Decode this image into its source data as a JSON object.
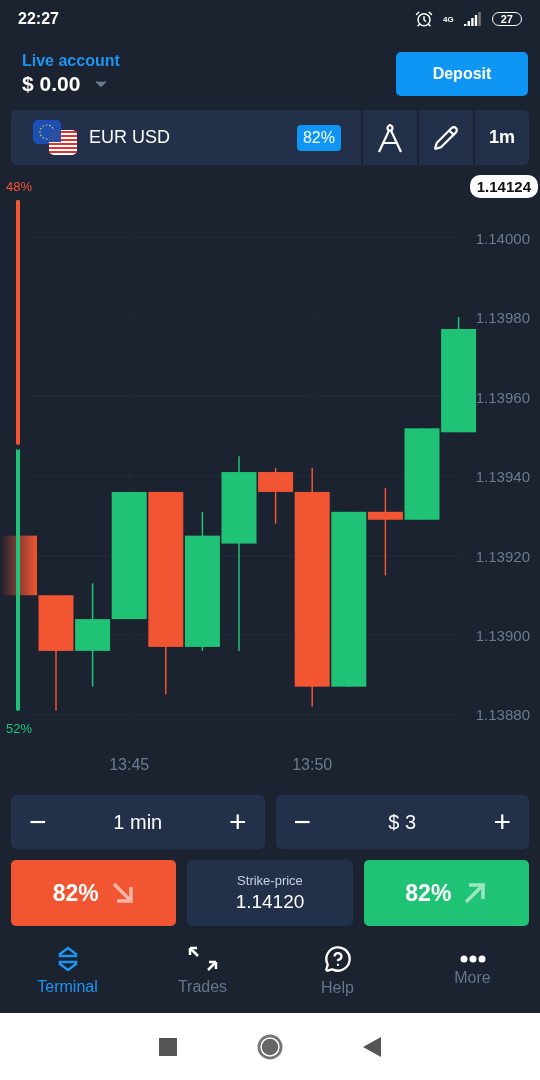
{
  "status_bar": {
    "time": "22:27",
    "network": "4G",
    "battery": "27"
  },
  "account": {
    "label": "Live account",
    "balance": "$ 0.00"
  },
  "deposit_button": "Deposit",
  "asset_bar": {
    "pair": "EUR USD",
    "payout": "82%",
    "timeframe": "1m"
  },
  "chart": {
    "current_price": "1.14124",
    "sentiment": {
      "down_label": "48%",
      "up_label": "52%",
      "level": 0.48
    },
    "price_labels": [
      "1.14000",
      "1.13980",
      "1.13960",
      "1.13940",
      "1.13920",
      "1.13900",
      "1.13880"
    ],
    "time_labels": [
      "13:45",
      "13:50"
    ]
  },
  "controls": [
    {
      "value": "1 min",
      "minus": "−",
      "plus": "+"
    },
    {
      "value": "$ 3",
      "minus": "−",
      "plus": "+"
    }
  ],
  "trade": {
    "down": "82%",
    "strike_label": "Strike-price",
    "strike_value": "1.14120",
    "up": "82%"
  },
  "nav": [
    {
      "label": "Terminal",
      "kind": "terminal",
      "selected": true
    },
    {
      "label": "Trades",
      "kind": "trades",
      "selected": false
    },
    {
      "label": "Help",
      "kind": "help",
      "selected": false
    },
    {
      "label": "More",
      "kind": "more",
      "selected": false
    }
  ]
}
